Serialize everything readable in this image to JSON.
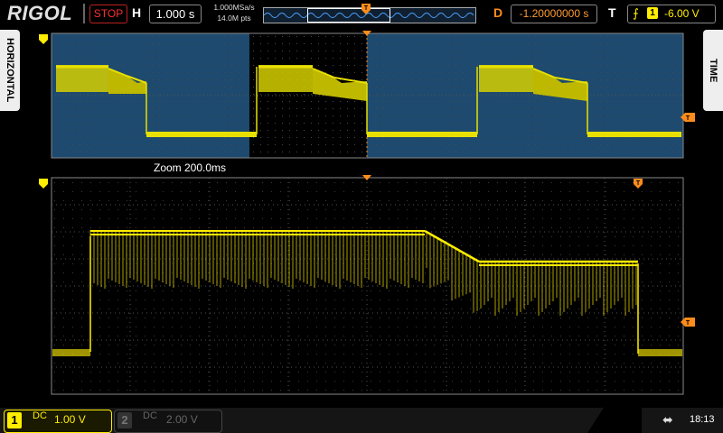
{
  "header": {
    "brand": "RIGOL",
    "run_state": "STOP",
    "horizontal_letter": "H",
    "timebase": "1.000 s",
    "sample_rate": "1.000MSa/s",
    "memory_depth": "14.0M pts",
    "delay_letter": "D",
    "delay_value": "-1.20000000 s",
    "trigger_letter": "T",
    "trigger_source": "1",
    "trigger_level": "-6.00 V"
  },
  "side_tabs": {
    "left": "HORIZONTAL",
    "right": "TIME"
  },
  "zoom": {
    "label": "Zoom  200.0ms"
  },
  "channels": [
    {
      "number": "1",
      "coupling": "DC",
      "scale": "1.00 V",
      "active": true
    },
    {
      "number": "2",
      "coupling": "DC",
      "scale": "2.00 V",
      "active": false
    }
  ],
  "status": {
    "clock": "18:13"
  },
  "colors": {
    "ch1": "#ffee00",
    "marker": "#ff8c1a",
    "zoom_bg": "#1d4a6e",
    "grid": "#5a5a5a"
  },
  "icons": {
    "trigger_edge": "rising-edge-icon",
    "usb": "usb-icon"
  }
}
